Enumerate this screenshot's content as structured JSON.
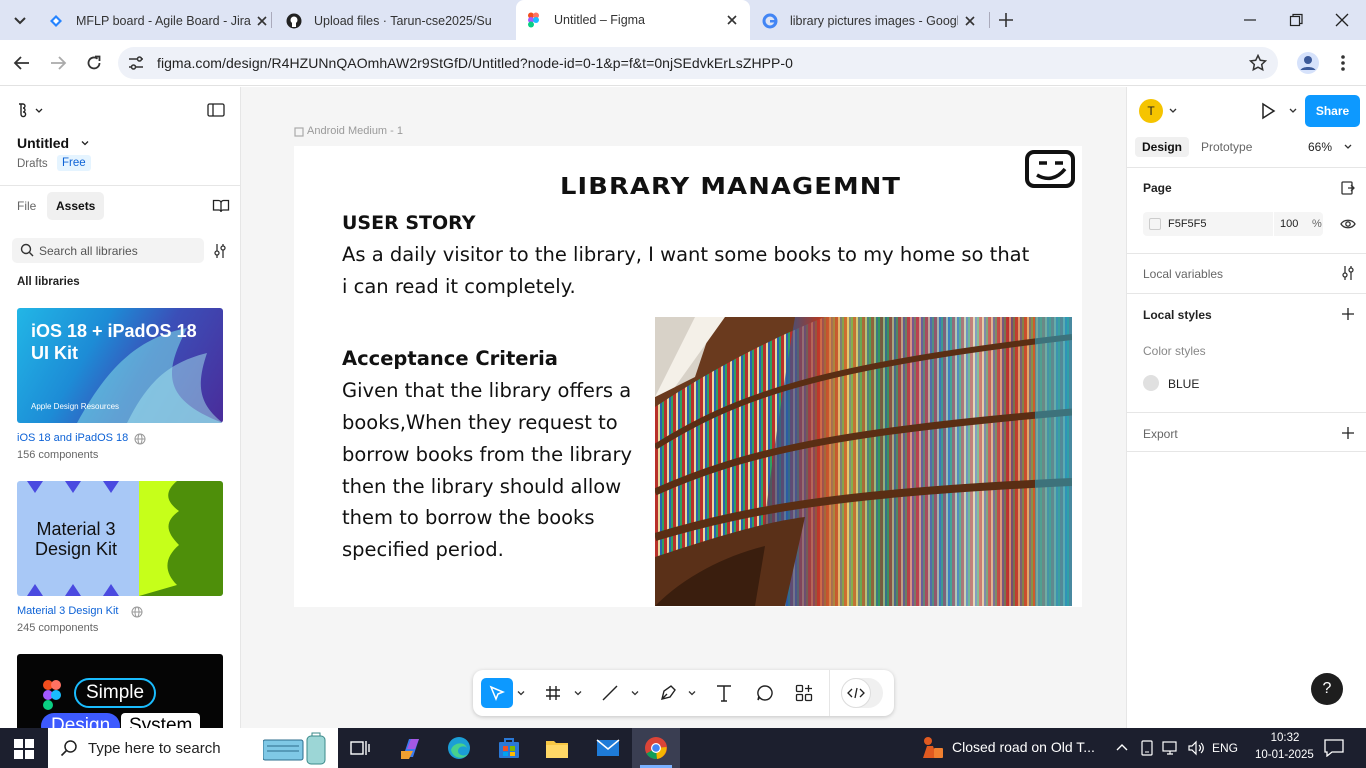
{
  "browser": {
    "tabs": [
      {
        "title": "MFLP board - Agile Board - Jira",
        "active": false
      },
      {
        "title": "Upload files · Tarun-cse2025/Su",
        "active": false
      },
      {
        "title": "Untitled – Figma",
        "active": true
      },
      {
        "title": "library pictures images - Googl",
        "active": false
      }
    ],
    "url": "figma.com/design/R4HZUNnQAOmhAW2r9StGfD/Untitled?node-id=0-1&p=f&t=0njSEdvkErLsZHPP-0"
  },
  "left": {
    "file_name": "Untitled",
    "location": "Drafts",
    "plan": "Free",
    "tabs": [
      "File",
      "Assets"
    ],
    "search_placeholder": "Search all libraries",
    "section": "All libraries",
    "libraries": [
      {
        "name": "iOS 18 and iPadOS 18",
        "count": "156 components",
        "thumb_title": "iOS 18 + iPadOS 18\nUI Kit",
        "thumb_sub": "Apple Design Resources"
      },
      {
        "name": "Material 3 Design Kit",
        "count": "245 components",
        "thumb_title": "Material 3\nDesign Kit"
      },
      {
        "thumb_a": "Simple",
        "thumb_b": "Design",
        "thumb_c": "System"
      }
    ]
  },
  "canvas": {
    "frame_label": "Android Medium - 1",
    "title": "LIBRARY MANAGEMNT",
    "user_story_heading": "USER STORY",
    "user_story_l1": "As a daily visitor to the library, I want some books to my home so that",
    "user_story_l2": "i can read it completely.",
    "acceptance_heading": "Acceptance Criteria",
    "acceptance_lines": [
      "Given that the library offers a",
      "books,When they request to",
      "borrow books from the library",
      "then the library should allow",
      "them to borrow the books",
      "specified period."
    ]
  },
  "right": {
    "avatar": "T",
    "share": "Share",
    "tabs": [
      "Design",
      "Prototype"
    ],
    "zoom": "66%",
    "page_heading": "Page",
    "page_color": "F5F5F5",
    "page_opacity": "100",
    "percent": "%",
    "local_variables": "Local variables",
    "local_styles": "Local styles",
    "color_styles": "Color styles",
    "style_name": "BLUE",
    "export": "Export",
    "help": "?"
  },
  "taskbar": {
    "search_placeholder": "Type here to search",
    "news": "Closed road on Old T...",
    "lang": "ENG",
    "time": "10:32",
    "date": "10-01-2025"
  },
  "colors": {
    "accent": "#0d99ff",
    "taskbar": "#1c1f2e",
    "tabbar": "#dee4f4"
  }
}
